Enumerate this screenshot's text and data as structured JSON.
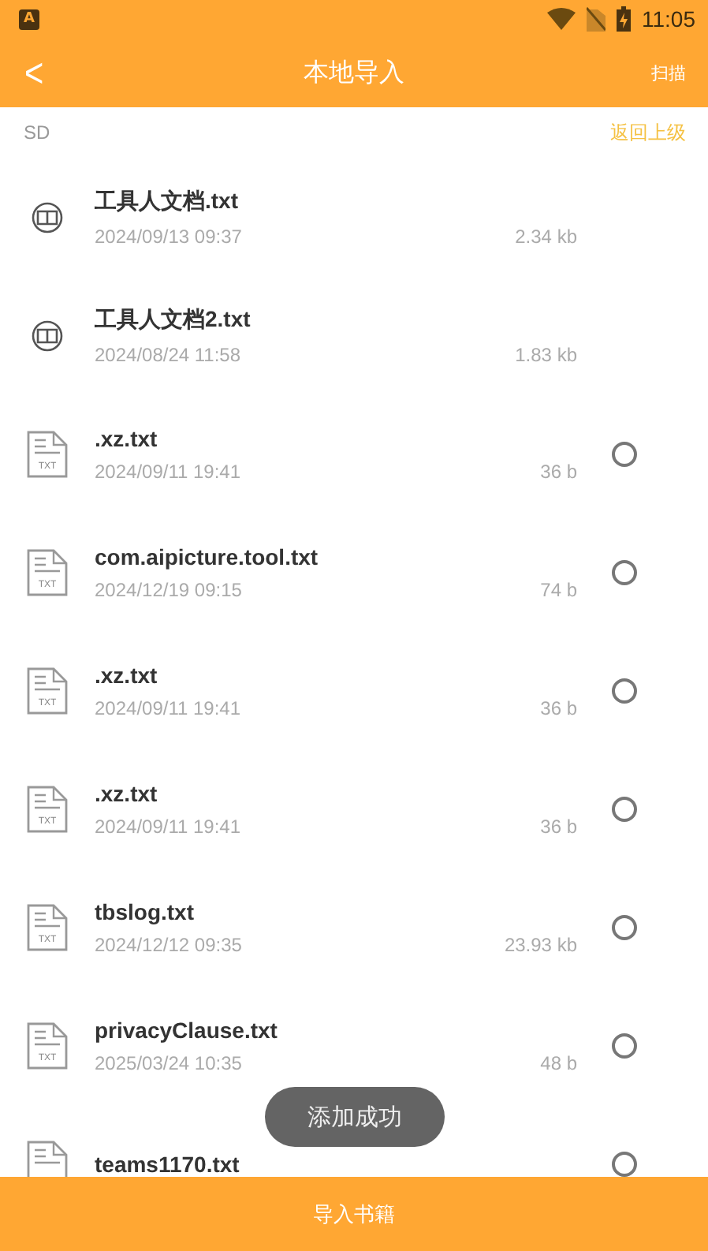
{
  "status_bar": {
    "time": "11:05",
    "app_badge": "A"
  },
  "app_bar": {
    "title": "本地导入",
    "back": "<",
    "action": "扫描"
  },
  "path_bar": {
    "path": "SD",
    "up": "返回上级"
  },
  "files": [
    {
      "kind": "book",
      "name": "工具人文档.txt",
      "date": "2024/09/13 09:37",
      "size": "2.34 kb"
    },
    {
      "kind": "book",
      "name": "工具人文档2.txt",
      "date": "2024/08/24 11:58",
      "size": "1.83 kb"
    },
    {
      "kind": "txt",
      "icon_text": "TXT",
      "name": ".xz.txt",
      "date": "2024/09/11 19:41",
      "size": "36 b",
      "selected": false
    },
    {
      "kind": "txt",
      "icon_text": "TXT",
      "name": "com.aipicture.tool.txt",
      "date": "2024/12/19 09:15",
      "size": "74 b",
      "selected": false
    },
    {
      "kind": "txt",
      "icon_text": "TXT",
      "name": ".xz.txt",
      "date": "2024/09/11 19:41",
      "size": "36 b",
      "selected": false
    },
    {
      "kind": "txt",
      "icon_text": "TXT",
      "name": ".xz.txt",
      "date": "2024/09/11 19:41",
      "size": "36 b",
      "selected": false
    },
    {
      "kind": "txt",
      "icon_text": "TXT",
      "name": "tbslog.txt",
      "date": "2024/12/12 09:35",
      "size": "23.93 kb",
      "selected": false
    },
    {
      "kind": "txt",
      "icon_text": "TXT",
      "name": "privacyClause.txt",
      "date": "2025/03/24 10:35",
      "size": "48 b",
      "selected": false
    },
    {
      "kind": "txt",
      "name": "teams1170.txt",
      "selected": false
    }
  ],
  "toast": "添加成功",
  "import_button": "导入书籍"
}
